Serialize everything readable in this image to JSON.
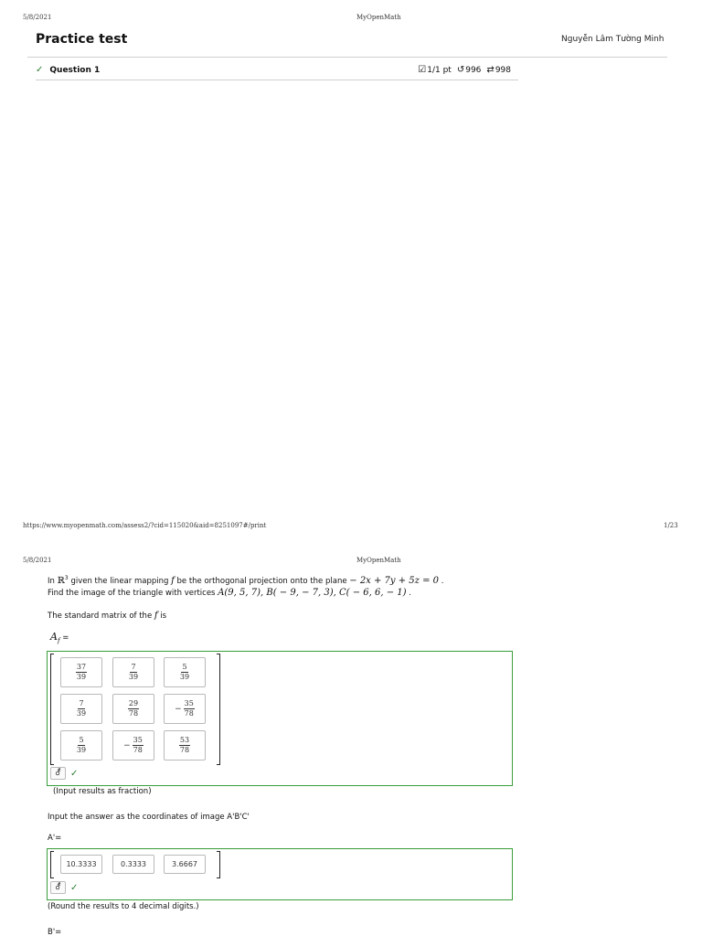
{
  "print": {
    "date": "5/8/2021",
    "site": "MyOpenMath",
    "url": "https://www.myopenmath.com/assess2/?cid=115020&aid=8251097#/print",
    "page_number": "1/23"
  },
  "header": {
    "title": "Practice test",
    "user_name": "Nguyễn Lâm Tường Minh"
  },
  "question": {
    "title": "Question 1",
    "score": "1/1 pt",
    "retries": "996",
    "attempts": "998"
  },
  "problem": {
    "line1_a": "In ",
    "space": "ℝ",
    "space_exp": "3",
    "line1_b": " given the linear mapping ",
    "map": "f",
    "line1_c": " be the orthogonal projection onto the plane ",
    "plane_eq": "− 2x + 7y + 5z = 0",
    "line1_end": " .",
    "line2_a": "Find the image of the triangle with vertices ",
    "vertices": "A(9, 5, 7),  B( − 9,  − 7, 3), C( − 6, 6,  − 1)",
    "line2_end": " .",
    "std_text": "The standard matrix of the ",
    "std_f": "f",
    "std_is": " is",
    "matrix_label": "A",
    "matrix_sub": "f",
    "matrix_eq": " ="
  },
  "matrix": [
    [
      {
        "sign": "",
        "num": "37",
        "den": "39"
      },
      {
        "sign": "",
        "num": "7",
        "den": "39"
      },
      {
        "sign": "",
        "num": "5",
        "den": "39"
      }
    ],
    [
      {
        "sign": "",
        "num": "7",
        "den": "39"
      },
      {
        "sign": "",
        "num": "29",
        "den": "78"
      },
      {
        "sign": "−",
        "num": "35",
        "den": "78"
      }
    ],
    [
      {
        "sign": "",
        "num": "5",
        "den": "39"
      },
      {
        "sign": "−",
        "num": "35",
        "den": "78"
      },
      {
        "sign": "",
        "num": "53",
        "den": "78"
      }
    ]
  ],
  "notes": {
    "matrix_note": "(Input results as fraction)",
    "coords_instruction": "Input the answer as the coordinates of image A'B'C'",
    "a_label": "A'=",
    "round_note": "(Round the results to 4 decimal digits.)",
    "b_label": "B'="
  },
  "a_prime": [
    "10.3333",
    "0.3333",
    "3.6667"
  ],
  "icons": {
    "correct": "check-icon",
    "gradebook": "checkbox-icon",
    "retry": "retry-icon",
    "attempts": "repeat-icon",
    "symbol": "gender-symbol-icon"
  },
  "colors": {
    "correct_green": "#2e7d32",
    "answer_border": "#3a9d3a"
  }
}
